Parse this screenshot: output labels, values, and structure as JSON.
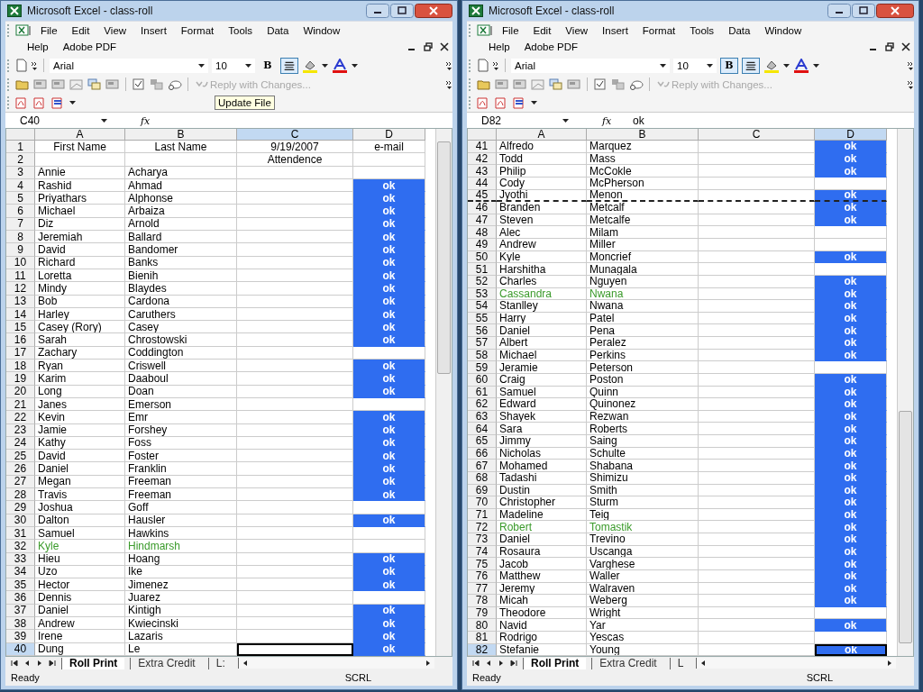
{
  "windows": [
    {
      "title": "Microsoft Excel - class-roll",
      "menu": [
        "File",
        "Edit",
        "View",
        "Insert",
        "Format",
        "Tools",
        "Data",
        "Window"
      ],
      "menu_row2": [
        "Help",
        "Adobe PDF"
      ],
      "font": "Arial",
      "font_size": "10",
      "bold": {
        "label": "B",
        "selected": false
      },
      "align_selected": true,
      "reply": {
        "label": "Reply with Changes...",
        "disabled": true
      },
      "tooltip": "Update File",
      "name_box": "C40",
      "fx_label": "fx",
      "columns": [
        {
          "label": "A",
          "selected": false
        },
        {
          "label": "B",
          "selected": false
        },
        {
          "label": "C",
          "selected": true
        },
        {
          "label": "D",
          "selected": false
        }
      ],
      "rows": [
        {
          "n": "1",
          "a": "First Name",
          "b": "Last Name",
          "c": "9/19/2007",
          "d": "e-mail",
          "kind": "header",
          "selected": false
        },
        {
          "n": "2",
          "a": "",
          "b": "",
          "c": "Attendence",
          "d": "",
          "kind": "header",
          "selected": false
        },
        {
          "n": "3",
          "a": "Annie",
          "b": "Acharya",
          "d": "",
          "selected": false
        },
        {
          "n": "4",
          "a": "Rashid",
          "b": "Ahmad",
          "d": "ok",
          "selected": false
        },
        {
          "n": "5",
          "a": "Priyathars",
          "b": "Alphonse",
          "d": "ok",
          "selected": false
        },
        {
          "n": "6",
          "a": "Michael",
          "b": "Arbaiza",
          "d": "ok",
          "selected": false
        },
        {
          "n": "7",
          "a": "Diz",
          "b": "Arnold",
          "d": "ok",
          "selected": false
        },
        {
          "n": "8",
          "a": "Jeremiah",
          "b": "Ballard",
          "d": "ok",
          "selected": false
        },
        {
          "n": "9",
          "a": "David",
          "b": "Bandomer",
          "d": "ok",
          "selected": false
        },
        {
          "n": "10",
          "a": "Richard",
          "b": "Banks",
          "d": "ok",
          "selected": false
        },
        {
          "n": "11",
          "a": "Loretta",
          "b": "Bienih",
          "d": "ok",
          "selected": false
        },
        {
          "n": "12",
          "a": "Mindy",
          "b": "Blaydes",
          "d": "ok",
          "selected": false
        },
        {
          "n": "13",
          "a": "Bob",
          "b": "Cardona",
          "d": "ok",
          "selected": false
        },
        {
          "n": "14",
          "a": "Harley",
          "b": "Caruthers",
          "d": "ok",
          "selected": false
        },
        {
          "n": "15",
          "a": "Casey (Rory)",
          "b": "Casey",
          "d": "ok",
          "selected": false
        },
        {
          "n": "16",
          "a": "Sarah",
          "b": "Chrostowski",
          "d": "ok",
          "selected": false
        },
        {
          "n": "17",
          "a": "Zachary",
          "b": "Coddington",
          "d": "",
          "selected": false
        },
        {
          "n": "18",
          "a": "Ryan",
          "b": "Criswell",
          "d": "ok",
          "selected": false
        },
        {
          "n": "19",
          "a": "Karim",
          "b": "Daaboul",
          "d": "ok",
          "selected": false
        },
        {
          "n": "20",
          "a": "Long",
          "b": "Doan",
          "d": "ok",
          "selected": false
        },
        {
          "n": "21",
          "a": "Janes",
          "b": "Emerson",
          "d": "",
          "selected": false
        },
        {
          "n": "22",
          "a": "Kevin",
          "b": "Emr",
          "d": "ok",
          "selected": false
        },
        {
          "n": "23",
          "a": "Jamie",
          "b": "Forshey",
          "d": "ok",
          "selected": false
        },
        {
          "n": "24",
          "a": "Kathy",
          "b": "Foss",
          "d": "ok",
          "selected": false
        },
        {
          "n": "25",
          "a": "David",
          "b": "Foster",
          "d": "ok",
          "selected": false
        },
        {
          "n": "26",
          "a": "Daniel",
          "b": "Franklin",
          "d": "ok",
          "selected": false
        },
        {
          "n": "27",
          "a": "Megan",
          "b": "Freeman",
          "d": "ok",
          "selected": false
        },
        {
          "n": "28",
          "a": "Travis",
          "b": "Freeman",
          "d": "ok",
          "selected": false
        },
        {
          "n": "29",
          "a": "Joshua",
          "b": "Goff",
          "d": "",
          "selected": false
        },
        {
          "n": "30",
          "a": "Dalton",
          "b": "Hausler",
          "d": "ok",
          "selected": false
        },
        {
          "n": "31",
          "a": "Samuel",
          "b": "Hawkins",
          "d": "",
          "selected": false
        },
        {
          "n": "32",
          "a": "Kyle",
          "b": "Hindmarsh",
          "d": "",
          "color": "#3a9a2a",
          "selected": false
        },
        {
          "n": "33",
          "a": "Hieu",
          "b": "Hoang",
          "d": "ok",
          "selected": false
        },
        {
          "n": "34",
          "a": "Uzo",
          "b": "Ike",
          "d": "ok",
          "selected": false
        },
        {
          "n": "35",
          "a": "Hector",
          "b": "Jimenez",
          "d": "ok",
          "selected": false
        },
        {
          "n": "36",
          "a": "Dennis",
          "b": "Juarez",
          "d": "",
          "selected": false
        },
        {
          "n": "37",
          "a": "Daniel",
          "b": "Kintigh",
          "d": "ok",
          "selected": false
        },
        {
          "n": "38",
          "a": "Andrew",
          "b": "Kwiecinski",
          "d": "ok",
          "selected": false
        },
        {
          "n": "39",
          "a": "Irene",
          "b": "Lazaris",
          "d": "ok",
          "selected": false
        },
        {
          "n": "40",
          "a": "Dung",
          "b": "Le",
          "d": "ok",
          "selected": true
        }
      ],
      "sheet_tabs": [
        {
          "label": "Roll Print",
          "selected": true
        },
        {
          "label": "Extra Credit",
          "selected": false
        },
        {
          "label": "L:",
          "selected": false
        }
      ],
      "status": "Ready",
      "mode": "SCRL"
    },
    {
      "title": "Microsoft Excel - class-roll",
      "menu": [
        "File",
        "Edit",
        "View",
        "Insert",
        "Format",
        "Tools",
        "Data",
        "Window"
      ],
      "menu_row2": [
        "Help",
        "Adobe PDF"
      ],
      "font": "Arial",
      "font_size": "10",
      "bold": {
        "label": "B",
        "selected": true
      },
      "align_selected": true,
      "reply": {
        "label": "Reply with Changes...",
        "disabled": true
      },
      "name_box": "D82",
      "fx_label": "fx",
      "formula": "ok",
      "columns": [
        {
          "label": "A",
          "selected": false
        },
        {
          "label": "B",
          "selected": false
        },
        {
          "label": "C",
          "selected": false
        },
        {
          "label": "D",
          "selected": true
        }
      ],
      "rows": [
        {
          "n": "41",
          "a": "Alfredo",
          "b": "Marquez",
          "d": "ok",
          "selected": false,
          "page_break": false
        },
        {
          "n": "42",
          "a": "Todd",
          "b": "Mass",
          "d": "ok",
          "selected": false,
          "page_break": false
        },
        {
          "n": "43",
          "a": "Philip",
          "b": "McCokle",
          "d": "ok",
          "selected": false,
          "page_break": false
        },
        {
          "n": "44",
          "a": "Cody",
          "b": "McPherson",
          "d": "",
          "selected": false,
          "page_break": false
        },
        {
          "n": "45",
          "a": "Jyothi",
          "b": "Menon",
          "d": "ok",
          "selected": false,
          "page_break": true
        },
        {
          "n": "46",
          "a": "Branden",
          "b": "Metcalf",
          "d": "ok",
          "selected": false,
          "page_break": false
        },
        {
          "n": "47",
          "a": "Steven",
          "b": "Metcalfe",
          "d": "ok",
          "selected": false,
          "page_break": false
        },
        {
          "n": "48",
          "a": "Alec",
          "b": "Milam",
          "d": "",
          "selected": false,
          "page_break": false
        },
        {
          "n": "49",
          "a": "Andrew",
          "b": "Miller",
          "d": "",
          "selected": false,
          "page_break": false
        },
        {
          "n": "50",
          "a": "Kyle",
          "b": "Moncrief",
          "d": "ok",
          "selected": false,
          "page_break": false
        },
        {
          "n": "51",
          "a": "Harshitha",
          "b": "Munagala",
          "d": "",
          "selected": false,
          "page_break": false
        },
        {
          "n": "52",
          "a": "Charles",
          "b": "Nguyen",
          "d": "ok",
          "selected": false,
          "page_break": false
        },
        {
          "n": "53",
          "a": "Cassandra",
          "b": "Nwana",
          "d": "ok",
          "color": "#3a9a2a",
          "selected": false,
          "page_break": false
        },
        {
          "n": "54",
          "a": "Stanlley",
          "b": "Nwana",
          "d": "ok",
          "selected": false,
          "page_break": false
        },
        {
          "n": "55",
          "a": "Harry",
          "b": "Patel",
          "d": "ok",
          "selected": false,
          "page_break": false
        },
        {
          "n": "56",
          "a": "Daniel",
          "b": "Pena",
          "d": "ok",
          "selected": false,
          "page_break": false
        },
        {
          "n": "57",
          "a": "Albert",
          "b": "Peralez",
          "d": "ok",
          "selected": false,
          "page_break": false
        },
        {
          "n": "58",
          "a": "Michael",
          "b": "Perkins",
          "d": "ok",
          "selected": false,
          "page_break": false
        },
        {
          "n": "59",
          "a": "Jeramie",
          "b": "Peterson",
          "d": "",
          "selected": false,
          "page_break": false
        },
        {
          "n": "60",
          "a": "Craig",
          "b": "Poston",
          "d": "ok",
          "selected": false,
          "page_break": false
        },
        {
          "n": "61",
          "a": "Samuel",
          "b": "Quinn",
          "d": "ok",
          "selected": false,
          "page_break": false
        },
        {
          "n": "62",
          "a": "Edward",
          "b": "Quinonez",
          "d": "ok",
          "selected": false,
          "page_break": false
        },
        {
          "n": "63",
          "a": "Shayek",
          "b": "Rezwan",
          "d": "ok",
          "selected": false,
          "page_break": false
        },
        {
          "n": "64",
          "a": "Sara",
          "b": "Roberts",
          "d": "ok",
          "selected": false,
          "page_break": false
        },
        {
          "n": "65",
          "a": "Jimmy",
          "b": "Saing",
          "d": "ok",
          "selected": false,
          "page_break": false
        },
        {
          "n": "66",
          "a": "Nicholas",
          "b": "Schulte",
          "d": "ok",
          "selected": false,
          "page_break": false
        },
        {
          "n": "67",
          "a": "Mohamed",
          "b": "Shabana",
          "d": "ok",
          "selected": false,
          "page_break": false
        },
        {
          "n": "68",
          "a": "Tadashi",
          "b": "Shimizu",
          "d": "ok",
          "selected": false,
          "page_break": false
        },
        {
          "n": "69",
          "a": "Dustin",
          "b": "Smith",
          "d": "ok",
          "selected": false,
          "page_break": false
        },
        {
          "n": "70",
          "a": "Christopher",
          "b": "Sturm",
          "d": "ok",
          "selected": false,
          "page_break": false
        },
        {
          "n": "71",
          "a": "Madeline",
          "b": "Teig",
          "d": "ok",
          "selected": false,
          "page_break": false
        },
        {
          "n": "72",
          "a": "Robert",
          "b": "Tomastik",
          "d": "ok",
          "color": "#3a9a2a",
          "selected": false,
          "page_break": false
        },
        {
          "n": "73",
          "a": "Daniel",
          "b": "Trevino",
          "d": "ok",
          "selected": false,
          "page_break": false
        },
        {
          "n": "74",
          "a": "Rosaura",
          "b": "Uscanga",
          "d": "ok",
          "selected": false,
          "page_break": false
        },
        {
          "n": "75",
          "a": "Jacob",
          "b": "Varghese",
          "d": "ok",
          "selected": false,
          "page_break": false
        },
        {
          "n": "76",
          "a": "Matthew",
          "b": "Waller",
          "d": "ok",
          "selected": false,
          "page_break": false
        },
        {
          "n": "77",
          "a": "Jeremy",
          "b": "Walraven",
          "d": "ok",
          "selected": false,
          "page_break": false
        },
        {
          "n": "78",
          "a": "Micah",
          "b": "Weberg",
          "d": "ok",
          "selected": false,
          "page_break": false
        },
        {
          "n": "79",
          "a": "Theodore",
          "b": "Wright",
          "d": "",
          "selected": false,
          "page_break": false
        },
        {
          "n": "80",
          "a": "Navid",
          "b": "Yar",
          "d": "ok",
          "selected": false,
          "page_break": false
        },
        {
          "n": "81",
          "a": "Rodrigo",
          "b": "Yescas",
          "d": "",
          "selected": false,
          "page_break": false
        },
        {
          "n": "82",
          "a": "Stefanie",
          "b": "Young",
          "d": "ok",
          "selected": true,
          "page_break": false
        }
      ],
      "sheet_tabs": [
        {
          "label": "Roll Print",
          "selected": true
        },
        {
          "label": "Extra Credit",
          "selected": false
        },
        {
          "label": "L",
          "selected": false
        }
      ],
      "status": "Ready",
      "mode": "SCRL"
    }
  ]
}
